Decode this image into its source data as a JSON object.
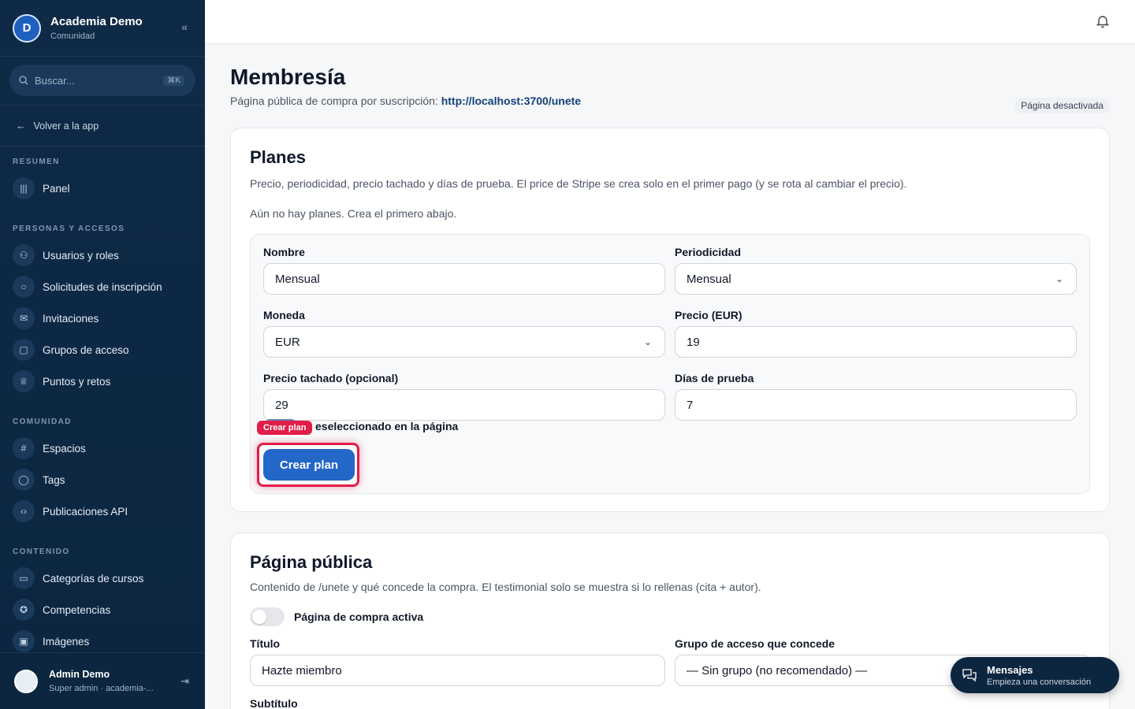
{
  "sidebar": {
    "brand": {
      "title": "Academia Demo",
      "subtitle": "Comunidad",
      "logo": "D"
    },
    "search": {
      "placeholder": "Buscar...",
      "shortcut": "⌘K"
    },
    "back_label": "Volver a la app",
    "sections": [
      {
        "label": "RESUMEN",
        "items": [
          {
            "label": "Panel",
            "icon": "bar-chart-icon"
          }
        ]
      },
      {
        "label": "PERSONAS Y ACCESOS",
        "items": [
          {
            "label": "Usuarios y roles",
            "icon": "users-icon"
          },
          {
            "label": "Solicitudes de inscripción",
            "icon": "user-icon"
          },
          {
            "label": "Invitaciones",
            "icon": "mail-icon"
          },
          {
            "label": "Grupos de acceso",
            "icon": "lock-icon"
          },
          {
            "label": "Puntos y retos",
            "icon": "trophy-icon"
          }
        ]
      },
      {
        "label": "COMUNIDAD",
        "items": [
          {
            "label": "Espacios",
            "icon": "hash-icon"
          },
          {
            "label": "Tags",
            "icon": "chat-icon"
          },
          {
            "label": "Publicaciones API",
            "icon": "code-icon"
          }
        ]
      },
      {
        "label": "CONTENIDO",
        "items": [
          {
            "label": "Categorías de cursos",
            "icon": "book-icon"
          },
          {
            "label": "Competencias",
            "icon": "award-icon"
          },
          {
            "label": "Imágenes",
            "icon": "image-icon"
          }
        ]
      }
    ],
    "user": {
      "name": "Admin Demo",
      "subtitle": "Super admin · academia-..."
    }
  },
  "page": {
    "title": "Membresía",
    "subtitle": "Página pública de compra por suscripción: ",
    "link": "http://localhost:3700/unete",
    "badge": "Página desactivada"
  },
  "plans": {
    "title": "Planes",
    "description": "Precio, periodicidad, precio tachado y días de prueba. El price de Stripe se crea solo en el primer pago (y se rota al cambiar el precio).",
    "empty": "Aún no hay planes. Crea el primero abajo.",
    "form": {
      "name_label": "Nombre",
      "name_value": "Mensual",
      "period_label": "Periodicidad",
      "period_value": "Mensual",
      "currency_label": "Moneda",
      "currency_value": "EUR",
      "price_label": "Precio (EUR)",
      "price_value": "19",
      "strike_label": "Precio tachado (opcional)",
      "strike_value": "29",
      "trial_label": "Días de prueba",
      "trial_value": "7",
      "preselect_label": "eseleccionado en la página",
      "tag": "Crear plan",
      "submit": "Crear plan"
    }
  },
  "public_page": {
    "title": "Página pública",
    "description": "Contenido de /unete y qué concede la compra. El testimonial solo se muestra si lo rellenas (cita + autor).",
    "toggle_label": "Página de compra activa",
    "title_label": "Título",
    "title_value": "Hazte miembro",
    "group_label": "Grupo de acceso que concede",
    "group_value": "— Sin grupo (no recomendado) —",
    "subtitle_label": "Subtítulo"
  },
  "chat": {
    "title": "Mensajes",
    "subtitle": "Empieza una conversación"
  }
}
